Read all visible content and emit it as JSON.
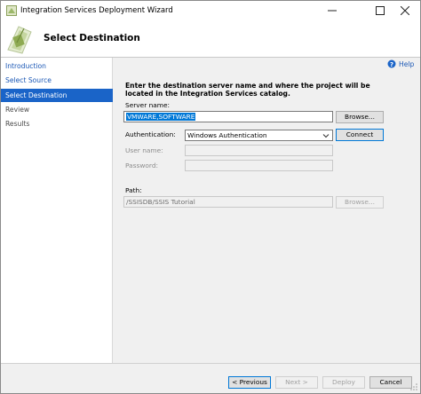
{
  "window": {
    "title": "Integration Services Deployment Wizard"
  },
  "header": {
    "title": "Select Destination"
  },
  "sidebar": {
    "items": [
      {
        "label": "Introduction",
        "state": "link"
      },
      {
        "label": "Select Source",
        "state": "link"
      },
      {
        "label": "Select Destination",
        "state": "active"
      },
      {
        "label": "Review",
        "state": "muted"
      },
      {
        "label": "Results",
        "state": "muted"
      }
    ]
  },
  "help": {
    "label": "Help"
  },
  "main": {
    "instruction": "Enter the destination server name and where the project will be located in the Integration Services catalog.",
    "server_name_label": "Server name:",
    "server_name_value": "VMWARE,SOFTWARE",
    "browse_server_label": "Browse...",
    "authentication_label": "Authentication:",
    "authentication_value": "Windows Authentication",
    "connect_label": "Connect",
    "user_name_label": "User name:",
    "user_name_value": "",
    "password_label": "Password:",
    "password_value": "",
    "path_label": "Path:",
    "path_value": "/SSISDB/SSIS Tutorial",
    "browse_path_label": "Browse..."
  },
  "footer": {
    "previous_label": "< Previous",
    "next_label": "Next >",
    "deploy_label": "Deploy",
    "cancel_label": "Cancel"
  },
  "colors": {
    "accent": "#1a64c8",
    "link": "#1a57b5",
    "selection": "#0078d7"
  },
  "icons": [
    "app-icon",
    "minimize-icon",
    "maximize-icon",
    "close-icon",
    "wizard-header-icon",
    "help-icon",
    "dropdown-arrow-icon",
    "resize-grip-icon"
  ]
}
